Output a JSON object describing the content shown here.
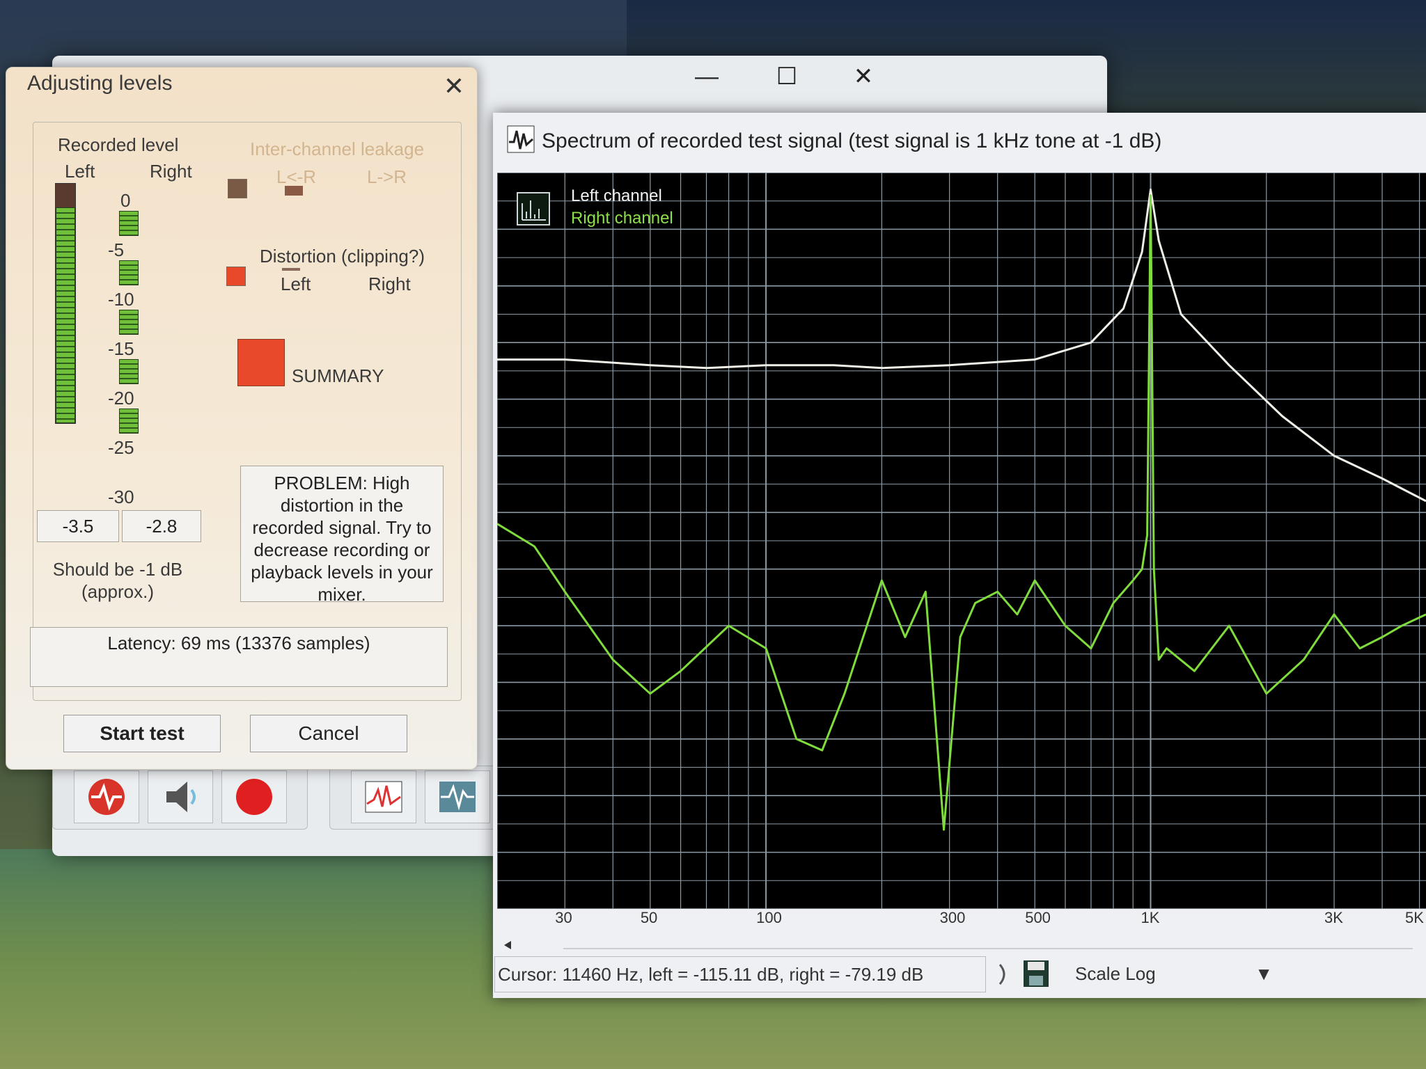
{
  "dialog": {
    "title": "Adjusting levels",
    "recorded_level_label": "Recorded level",
    "left_label": "Left",
    "right_label": "Right",
    "scale_ticks": [
      "0",
      "-5",
      "-10",
      "-15",
      "-20",
      "-25",
      "-30"
    ],
    "left_value": "-3.5",
    "right_value": "-2.8",
    "should_be_line1": "Should be  -1 dB",
    "should_be_line2": "(approx.)",
    "leakage_label": "Inter-channel leakage",
    "leakage_lr": "L<-R",
    "leakage_rl": "L->R",
    "distortion_label": "Distortion (clipping?)",
    "distortion_left": "Left",
    "distortion_right": "Right",
    "summary_label": "SUMMARY",
    "problem_text": "PROBLEM: High distortion in the recorded signal. Try to decrease recording or playback levels in your mixer.",
    "latency_text": "Latency: 69 ms (13376 samples)",
    "start_button": "Start test",
    "cancel_button": "Cancel",
    "left_level_fraction": 0.9,
    "colors": {
      "warn": "#e8492a",
      "meter": "#6fbf3a"
    }
  },
  "spectrum": {
    "title": "Spectrum of recorded test signal (test signal is 1 kHz tone at -1 dB)",
    "legend_left": "Left channel",
    "legend_right": "Right channel",
    "status": "Cursor:  11460 Hz,  left = -115.11 dB,  right = -79.19 dB",
    "scale_label": "Scale",
    "scale_value": "Log",
    "colors": {
      "left": "#f0f0e8",
      "right": "#7fdc3c",
      "grid": "#8c9aa6"
    }
  },
  "chart_data": {
    "type": "line",
    "x_scale": "log",
    "x_ticks": [
      "30",
      "50",
      "100",
      "300",
      "500",
      "1K",
      "3K",
      "5K"
    ],
    "x_tick_values": [
      30,
      50,
      100,
      300,
      500,
      1000,
      3000,
      5000
    ],
    "xlim": [
      20,
      5200
    ],
    "ylim": [
      -130,
      0
    ],
    "grid": true,
    "legend": "top-left",
    "series": [
      {
        "name": "Left channel",
        "x": [
          20,
          30,
          50,
          70,
          100,
          150,
          200,
          300,
          500,
          700,
          850,
          950,
          1000,
          1050,
          1200,
          1600,
          2200,
          3000,
          4000,
          5200
        ],
        "y": [
          -33,
          -33,
          -34,
          -34.5,
          -34,
          -34,
          -34.5,
          -34,
          -33,
          -30,
          -24,
          -14,
          -3,
          -12,
          -25,
          -34,
          -43,
          -50,
          -54,
          -58
        ]
      },
      {
        "name": "Right channel",
        "x": [
          20,
          25,
          30,
          40,
          50,
          60,
          80,
          100,
          120,
          140,
          160,
          200,
          230,
          260,
          290,
          320,
          350,
          400,
          450,
          500,
          600,
          700,
          800,
          900,
          950,
          980,
          1000,
          1020,
          1050,
          1100,
          1300,
          1600,
          2000,
          2500,
          3000,
          3500,
          4000,
          4500,
          5200
        ],
        "y": [
          -62,
          -66,
          -74,
          -86,
          -92,
          -88,
          -80,
          -84,
          -100,
          -102,
          -92,
          -72,
          -82,
          -74,
          -116,
          -82,
          -76,
          -74,
          -78,
          -72,
          -80,
          -84,
          -76,
          -72,
          -70,
          -64,
          -4,
          -70,
          -86,
          -84,
          -88,
          -80,
          -92,
          -86,
          -78,
          -84,
          -82,
          -80,
          -78
        ]
      }
    ]
  }
}
